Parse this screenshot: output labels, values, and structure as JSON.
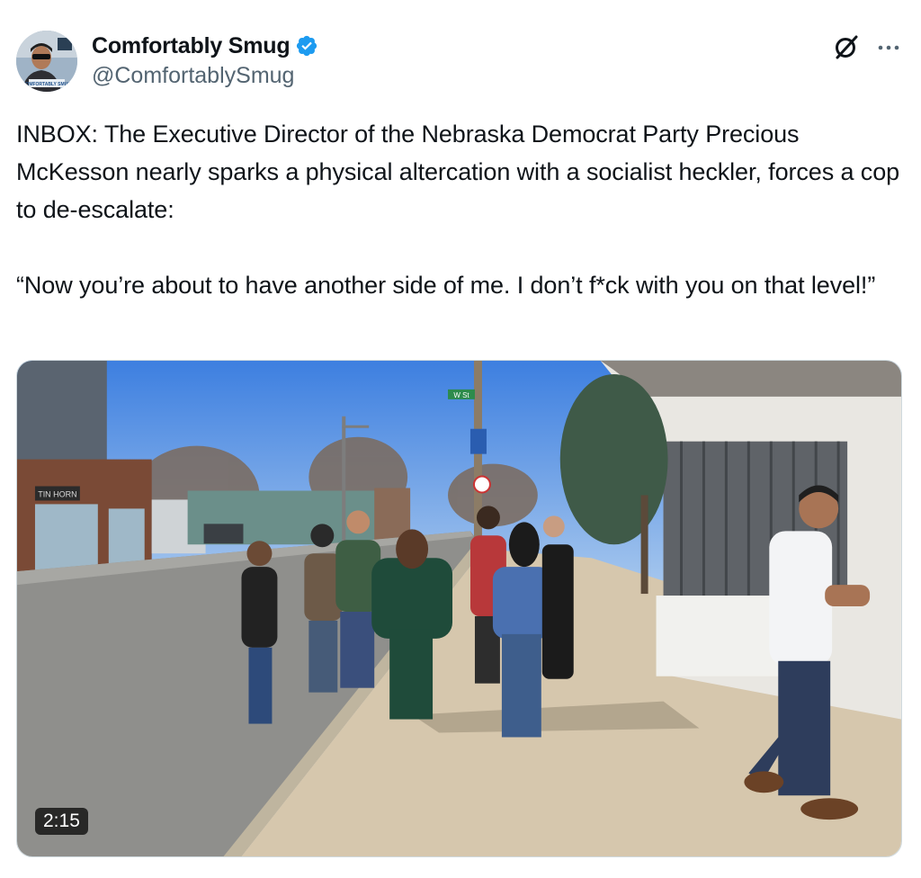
{
  "author": {
    "display_name": "Comfortably Smug",
    "handle": "@ComfortablySmug",
    "verified": true,
    "avatar_label": "COMFORTABLY SMUG"
  },
  "header_icons": {
    "grok": "grok-icon",
    "more": "more-icon"
  },
  "tweet": {
    "paragraph_1": "INBOX: The Executive Director of the Nebraska Democrat Party Precious McKesson nearly sparks a physical altercation with a socialist heckler, forces a cop to de-escalate:",
    "paragraph_2": "“Now you’re about to have another side of me. I don’t f*ck with you on that level!”"
  },
  "media": {
    "type": "video",
    "duration": "2:15",
    "street_sign": "W St",
    "store_sign": "TIN HORN"
  },
  "colors": {
    "verified": "#1d9bf0",
    "text": "#0f1419",
    "secondary": "#536471"
  }
}
